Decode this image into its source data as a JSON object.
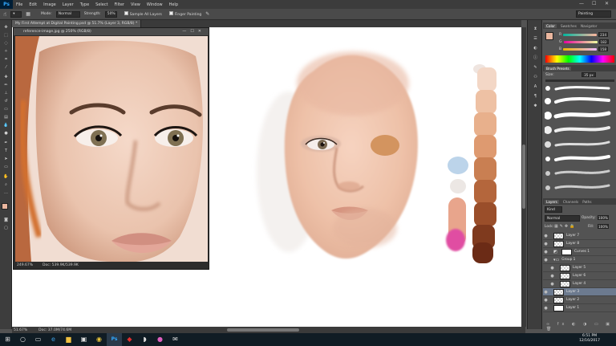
{
  "app": {
    "logo": "Ps"
  },
  "menu": [
    "File",
    "Edit",
    "Image",
    "Layer",
    "Type",
    "Select",
    "Filter",
    "View",
    "Window",
    "Help"
  ],
  "window_controls": {
    "min": "—",
    "max": "☐",
    "close": "✕"
  },
  "options": {
    "mode_label": "Mode:",
    "mode_value": "Normal",
    "strength_label": "Strength:",
    "strength_value": "50%",
    "sample_all": "Sample All Layers",
    "finger": "Finger Painting"
  },
  "workspace": "Painting",
  "doc_tab": "My First Attempt at Digital Painting.psd @ 51.7% (Layer 3, RGB/8) *",
  "ref_window": {
    "title": "reference-image.jpg @ 250% (RGB/8)",
    "zoom": "249.67%",
    "doc": "Doc: 539.9K/539.9K"
  },
  "status": {
    "zoom": "51.67%",
    "doc": "Doc: 37.0M/74.6M"
  },
  "color_panel": {
    "tabs": [
      "Color",
      "Swatches",
      "Navigator"
    ],
    "r": "234",
    "g": "182",
    "b": "158",
    "fg": "#eab69e"
  },
  "brush_panel": {
    "tabs": [
      "Brush Presets"
    ],
    "size_label": "Size:",
    "size_value": "35 px"
  },
  "layers_panel": {
    "tabs": [
      "Layers",
      "Channels",
      "Paths"
    ],
    "kind": "Kind",
    "blend": "Normal",
    "opacity_label": "Opacity:",
    "opacity": "100%",
    "lock_label": "Lock:",
    "fill_label": "Fill:",
    "fill": "100%",
    "layers": [
      {
        "name": "Layer 7"
      },
      {
        "name": "Layer 8"
      },
      {
        "name": "Curves 1"
      },
      {
        "name": "Group 1"
      },
      {
        "name": "Layer 5"
      },
      {
        "name": "Layer 6"
      },
      {
        "name": "Layer 4"
      },
      {
        "name": "Layer 3"
      },
      {
        "name": "Layer 2"
      },
      {
        "name": "Layer 1"
      }
    ]
  },
  "clock": {
    "time": "6:51 PM",
    "date": "12/16/2017"
  },
  "palette_colors": [
    "#f3d7c6",
    "#eec1a4",
    "#e8b08c",
    "#de9a70",
    "#c97f52",
    "#b4663c",
    "#9a4e2a",
    "#7f3a1e",
    "#6b2b16"
  ]
}
